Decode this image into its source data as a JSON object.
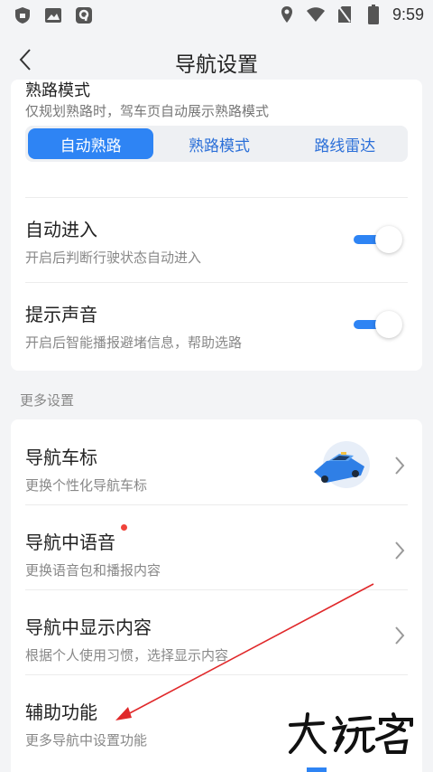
{
  "status_bar": {
    "time": "9:59",
    "left_icons": [
      "shield-icon",
      "image-icon",
      "app-badge-icon"
    ],
    "right_icons": [
      "location-icon",
      "wifi-icon",
      "no-sim-icon",
      "battery-icon"
    ]
  },
  "header": {
    "title": "导航设置",
    "back_icon": "chevron-left-icon"
  },
  "top_card": {
    "partial_title": "熟路模式",
    "partial_desc": "仅规划熟路时，驾车页自动展示熟路模式",
    "segments": [
      {
        "label": "自动熟路",
        "active": true
      },
      {
        "label": "熟路模式",
        "active": false
      },
      {
        "label": "路线雷达",
        "active": false
      }
    ],
    "rows": [
      {
        "title": "自动进入",
        "desc": "开启后判断行驶状态自动进入",
        "toggle_on": true
      },
      {
        "title": "提示声音",
        "desc": "开启后智能播报避堵信息，帮助选路",
        "toggle_on": true
      }
    ]
  },
  "more_settings": {
    "section_label": "更多设置",
    "rows": [
      {
        "title": "导航车标",
        "desc": "更换个性化导航车标",
        "has_car_image": true
      },
      {
        "title": "导航中语音",
        "desc": "更换语音包和播报内容",
        "has_red_dot": true
      },
      {
        "title": "导航中显示内容",
        "desc": "根据个人使用习惯，选择显示内容"
      },
      {
        "title": "辅助功能",
        "desc": "更多导航中设置功能"
      }
    ]
  },
  "watermark": "大玩客",
  "colors": {
    "accent": "#2e84f4",
    "background": "#f3f4f6",
    "annotation_arrow": "#e0282a",
    "red_dot": "#f0433a"
  }
}
